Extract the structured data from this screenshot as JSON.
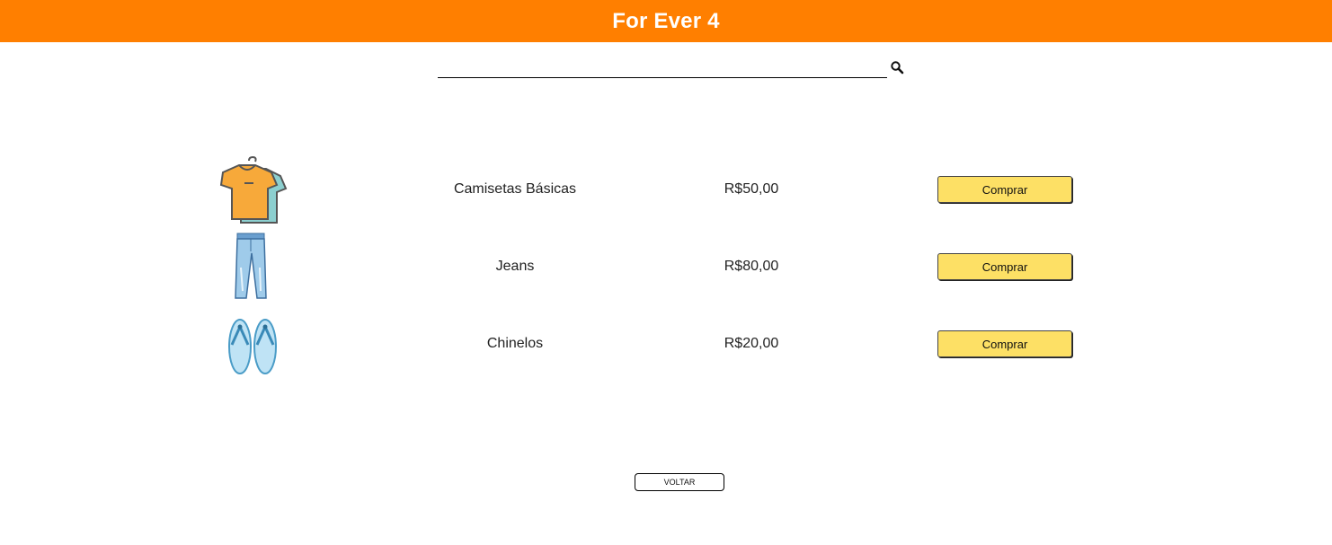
{
  "header": {
    "title": "For Ever 4",
    "bg_color": "#ff7f00"
  },
  "search": {
    "value": "",
    "placeholder": "",
    "icon": "search-icon"
  },
  "products": [
    {
      "image": "tshirt-image",
      "name": "Camisetas Básicas",
      "price": "R$50,00",
      "buy_label": "Comprar"
    },
    {
      "image": "jeans-image",
      "name": "Jeans",
      "price": "R$80,00",
      "buy_label": "Comprar"
    },
    {
      "image": "flip-flops-image",
      "name": "Chinelos",
      "price": "R$20,00",
      "buy_label": "Comprar"
    }
  ],
  "footer": {
    "back_label": "VOLTAR"
  },
  "colors": {
    "accent": "#ff7f00",
    "button": "#fde065"
  }
}
